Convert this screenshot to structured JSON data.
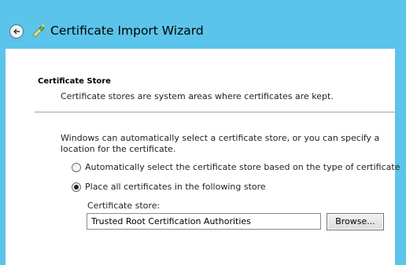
{
  "window": {
    "title": "Certificate Import Wizard"
  },
  "header": {
    "section_title": "Certificate Store",
    "section_description": "Certificate stores are system areas where certificates are kept."
  },
  "body": {
    "explanation": "Windows can automatically select a certificate store, or you can specify a location for the certificate.",
    "options": [
      {
        "label": "Automatically select the certificate store based on the type of certificate",
        "selected": false
      },
      {
        "label": "Place all certificates in the following store",
        "selected": true
      }
    ],
    "store_label": "Certificate store:",
    "store_value": "Trusted Root Certification Authorities",
    "browse_label": "Browse..."
  },
  "colors": {
    "titlebar": "#5bc4ea",
    "content": "#ffffff"
  },
  "icons": {
    "back": "back-arrow-icon",
    "app": "certificate-wizard-icon"
  }
}
